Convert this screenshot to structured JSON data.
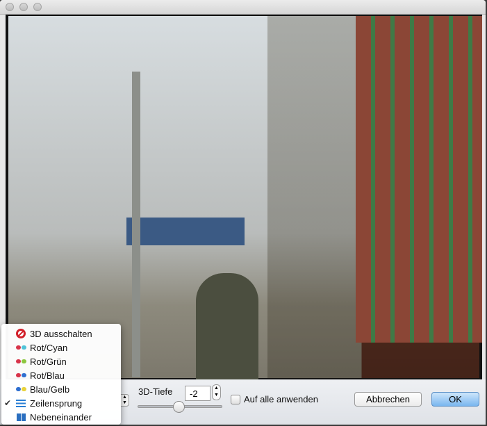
{
  "window": {
    "title": ""
  },
  "menu": {
    "items": [
      {
        "label": "3D ausschalten",
        "icon": "no-entry-icon",
        "checked": false
      },
      {
        "label": "Rot/Cyan",
        "icon": "glasses-icon",
        "colors": [
          "#d8344a",
          "#4fc3d8"
        ],
        "checked": false
      },
      {
        "label": "Rot/Grün",
        "icon": "glasses-icon",
        "colors": [
          "#d8344a",
          "#8cc63e"
        ],
        "checked": false
      },
      {
        "label": "Rot/Blau",
        "icon": "glasses-icon",
        "colors": [
          "#d8344a",
          "#2f6fd0"
        ],
        "checked": false
      },
      {
        "label": "Blau/Gelb",
        "icon": "glasses-icon",
        "colors": [
          "#2f6fd0",
          "#e8d23a"
        ],
        "checked": false
      },
      {
        "label": "Zeilensprung",
        "icon": "lines-icon",
        "checked": true
      },
      {
        "label": "Nebeneinander",
        "icon": "side-by-side-icon",
        "checked": false
      }
    ],
    "check_mark": "✔"
  },
  "controls": {
    "depth_label": "3D-Tiefe",
    "depth_value": "-2",
    "depth_slider_fraction": 0.48,
    "apply_all_label": "Auf alle anwenden",
    "apply_all_checked": false,
    "cancel_label": "Abbrechen",
    "ok_label": "OK"
  },
  "colors": {
    "ok_accent": "#79b6ef"
  }
}
